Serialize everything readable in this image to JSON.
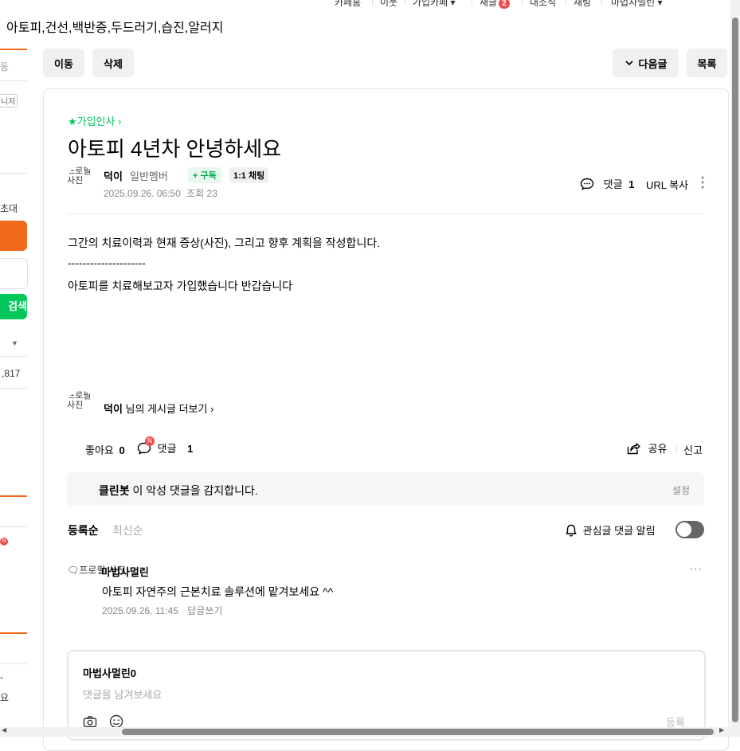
{
  "topnav": {
    "items": [
      "카페홈",
      "이웃",
      "가입카페",
      "새글",
      "내소식",
      "채팅",
      "마법사멀린"
    ],
    "new_count": "2"
  },
  "cafe_title": "아토피,건선,백반증,두드러기,습진,알러지",
  "sidebar": {
    "frag_top": "동",
    "frag_manage": "니저",
    "frag_invite": "초대",
    "frag_search": "검색",
    "frag_count": ",817",
    "frag_badge": "N",
    "frag_bottom1": "-",
    "frag_bottom2": "요"
  },
  "toolbar": {
    "move": "이동",
    "delete": "삭제",
    "next": "다음글",
    "list": "목록"
  },
  "article": {
    "board": "★가입인사",
    "title": "아토피 4년차 안녕하세요",
    "avatar_alt": "프로필 사진",
    "author": "덕이",
    "grade": "일반멤버",
    "subscribe": "+ 구독",
    "chat": "1:1 채팅",
    "date": "2025.09.26. 06:50",
    "views_label": "조회",
    "views": "23",
    "comment_label": "댓글",
    "comment_count": "1",
    "url_copy": "URL 복사",
    "body": [
      "그간의 치료이력과 현재 증상(사진), 그리고 향후 계획을 작성합니다.",
      "---------------------",
      "아토피를 치료해보고자 가입했습니다 반갑습니다"
    ],
    "more_author": "덕이",
    "more_text": "님의 게시글 더보기"
  },
  "reactions": {
    "like_label": "좋아요",
    "like_count": "0",
    "comment_label": "댓글",
    "comment_count": "1",
    "new_badge": "N",
    "share": "공유",
    "report": "신고"
  },
  "cleanbot": {
    "name": "클린봇",
    "text": "이 악성 댓글을 감지합니다.",
    "settings": "설정"
  },
  "comments": {
    "sort_registered": "등록순",
    "sort_latest": "최신순",
    "notify_label": "관심글 댓글 알림",
    "items": [
      {
        "avatar_alt": "프로필 사진",
        "author": "마법사멀린",
        "text": "아토피 자연주의 근본치료 솔루션에 맡겨보세요 ^^",
        "date": "2025.09.26. 11:45",
        "reply": "답글쓰기"
      }
    ]
  },
  "editor": {
    "user": "마법사멀린0",
    "placeholder": "댓글을 남겨보세요",
    "submit": "등록"
  },
  "colors": {
    "accent_green": "#03c75a",
    "accent_orange": "#f26a1b",
    "badge_red": "#f04c4c"
  }
}
